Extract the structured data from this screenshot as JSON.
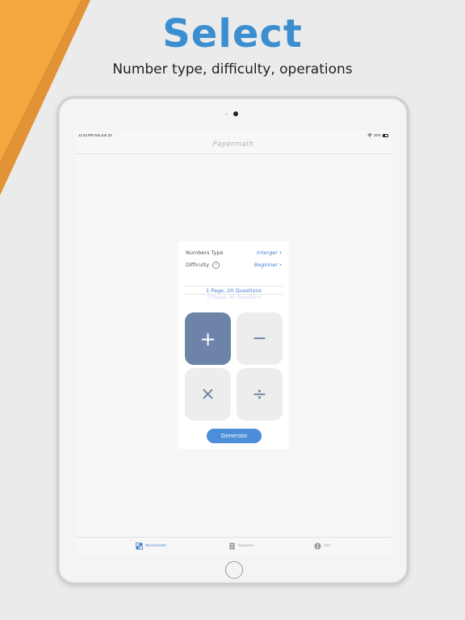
{
  "promo": {
    "headline": "Select",
    "subheadline": "Number type, difficulty, operations"
  },
  "status_bar": {
    "time": "11:43 PM   Sat Jun 22",
    "battery": "20%"
  },
  "nav": {
    "title": "Papermath"
  },
  "settings": {
    "number_type": {
      "label": "Numbers Type",
      "value": "Interger"
    },
    "difficulty": {
      "label": "Difficulty",
      "value": "Beginner",
      "info_glyph": "i"
    }
  },
  "pages_picker": {
    "selected": "1 Page, 20 Questions",
    "next": "2 Pages, 40 Questions"
  },
  "operations": [
    {
      "id": "addition",
      "symbol": "+",
      "selected": true
    },
    {
      "id": "subtraction",
      "symbol": "−",
      "selected": false
    },
    {
      "id": "multiplication",
      "symbol": "×",
      "selected": false
    },
    {
      "id": "division",
      "symbol": "÷",
      "selected": false
    }
  ],
  "generate_label": "Generate",
  "tabs": [
    {
      "label": "Worksheets",
      "icon": "grid-icon",
      "active": true
    },
    {
      "label": "Answers",
      "icon": "document-icon",
      "active": false
    },
    {
      "label": "Info",
      "icon": "info-icon",
      "active": false
    }
  ],
  "colors": {
    "brand_blue": "#3b8fd0",
    "accent_orange": "#f3a23a",
    "selected_tile": "#6e83a8",
    "button_blue": "#4d8ed8"
  }
}
